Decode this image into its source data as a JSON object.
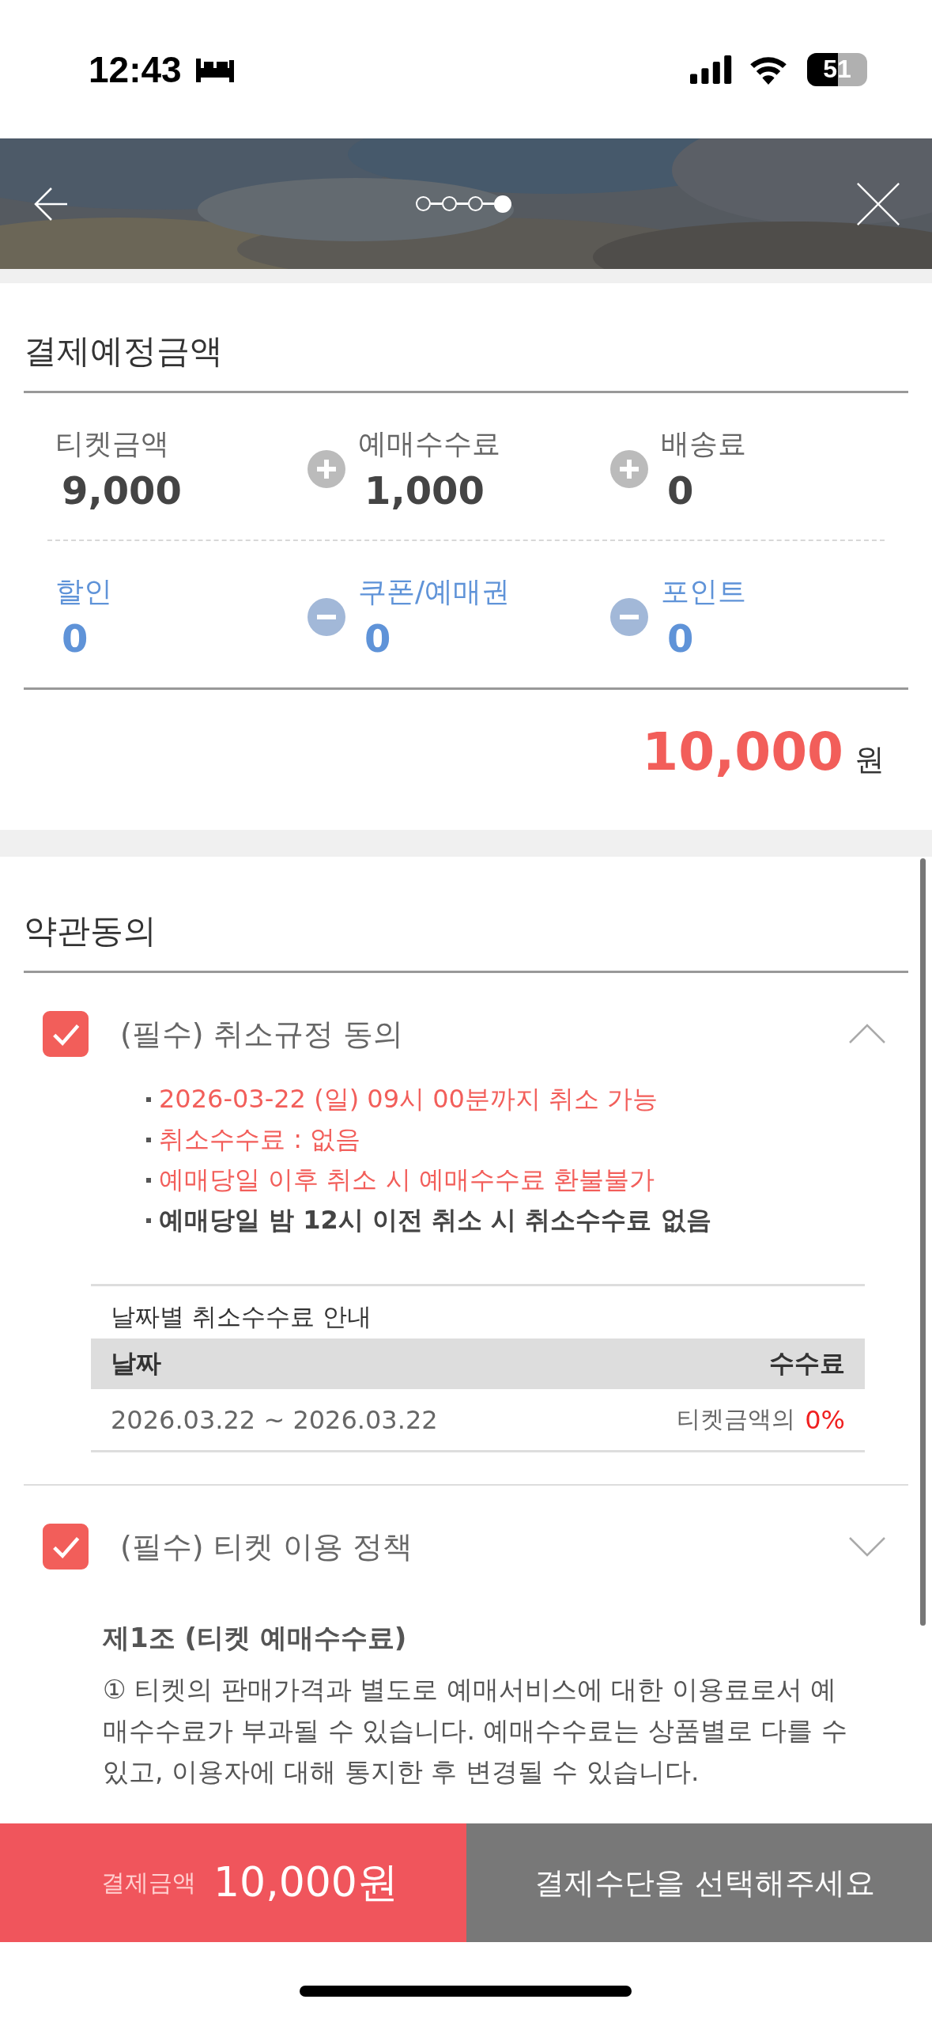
{
  "status_bar": {
    "time": "12:43",
    "battery": "51"
  },
  "header": {
    "steps": [
      {
        "selected": false
      },
      {
        "selected": false
      },
      {
        "selected": false
      },
      {
        "selected": true
      }
    ]
  },
  "payment_summary": {
    "title": "결제예정금액",
    "rows": [
      {
        "kind": "charge",
        "items": [
          {
            "label": "티켓금액",
            "value": "9,000"
          },
          {
            "label": "예매수수료",
            "value": "1,000"
          },
          {
            "label": "배송료",
            "value": "0"
          }
        ]
      },
      {
        "kind": "discount",
        "items": [
          {
            "label": "할인",
            "value": "0"
          },
          {
            "label": "쿠폰/예매권",
            "value": "0"
          },
          {
            "label": "포인트",
            "value": "0"
          }
        ]
      }
    ],
    "total": "10,000",
    "currency": "원"
  },
  "terms": {
    "title": "약관동의",
    "items": [
      {
        "title": "(필수) 취소규정 동의",
        "checked": true,
        "expanded": true,
        "bullets": [
          {
            "kind": "alert",
            "text": "2026-03-22 (일) 09시 00분까지 취소 가능"
          },
          {
            "kind": "alert",
            "text": "취소수수료 : 없음"
          },
          {
            "kind": "alert",
            "text": "예매당일 이후 취소 시 예매수수료 환불불가"
          },
          {
            "kind": "bold",
            "text": "예매당일 밤 12시 이전 취소 시 취소수수료 없음"
          }
        ],
        "fee_table": {
          "caption": "날짜별 취소수수료 안내",
          "columns": [
            "날짜",
            "수수료"
          ],
          "rows": [
            {
              "date": "2026.03.22 ~ 2026.03.22",
              "fee_prefix": "티켓금액의",
              "fee": "0%"
            }
          ]
        }
      },
      {
        "title": "(필수) 티켓 이용 정책",
        "checked": true,
        "expanded": false
      }
    ],
    "article": {
      "title": "제1조 (티켓 예매수수료)",
      "paragraph": "① 티켓의 판매가격과 별도로 예매서비스에 대한 이용료로서 예매수수료가 부과될 수 있습니다. 예매수수료는 상품별로 다를 수 있고, 이용자에 대해 통지한 후 변경될 수 있습니다."
    }
  },
  "bottom_bar": {
    "amount_label": "결제금액",
    "amount": "10,000원",
    "pay_button": "결제수단을 선택해주세요"
  }
}
